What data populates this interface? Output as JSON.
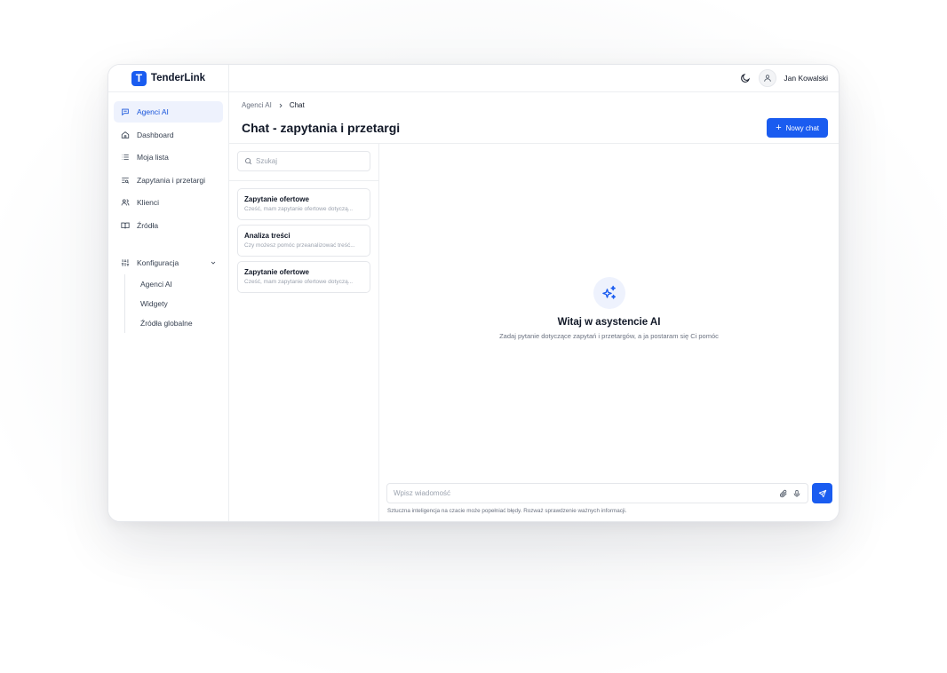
{
  "app": {
    "name": "TenderLink",
    "logo_letter": "T",
    "accent_color": "#1a5cf0"
  },
  "sidebar": {
    "items": [
      {
        "label": "Agenci AI",
        "icon": "chat-bubble-icon",
        "active": true
      },
      {
        "label": "Dashboard",
        "icon": "home-icon"
      },
      {
        "label": "Moja lista",
        "icon": "list-icon"
      },
      {
        "label": "Zapytania i przetargi",
        "icon": "list-search-icon"
      },
      {
        "label": "Klienci",
        "icon": "users-icon"
      },
      {
        "label": "Źródła",
        "icon": "book-icon"
      }
    ],
    "config": {
      "label": "Konfiguracja",
      "icon": "sliders-icon",
      "children": [
        "Agenci AI",
        "Widgety",
        "Źródła globalne"
      ]
    }
  },
  "topbar": {
    "user_name": "Jan Kowalski",
    "theme_icon": "moon-icon",
    "avatar_icon": "user-icon"
  },
  "header": {
    "breadcrumb": [
      "Agenci AI",
      "Chat"
    ],
    "title": "Chat - zapytania i przetargi",
    "new_chat_label": "Nowy chat"
  },
  "chat_list": {
    "search_placeholder": "Szukaj",
    "threads": [
      {
        "title": "Zapytanie ofertowe",
        "preview": "Cześć, mam zapytanie ofertowe dotyczą..."
      },
      {
        "title": "Analiza treści",
        "preview": "Czy możesz pomóc przeanalizować treść..."
      },
      {
        "title": "Zapytanie ofertowe",
        "preview": "Cześć, mam zapytanie ofertowe dotyczą..."
      }
    ]
  },
  "chat": {
    "welcome_title": "Witaj w asystencie AI",
    "welcome_subtitle": "Zadaj pytanie dotyczące zapytań i przetargów, a ja postaram się Ci pomóc",
    "message_placeholder": "Wpisz wiadomość",
    "disclaimer": "Sztuczna inteligencja na czacie może popełniać błędy. Rozważ sprawdzenie ważnych informacji."
  }
}
